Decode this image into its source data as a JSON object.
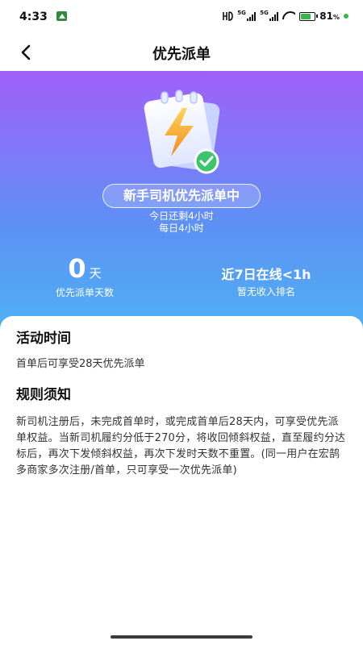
{
  "status_bar": {
    "time": "4:33",
    "signal1_tag": "5G",
    "signal2_tag": "5G",
    "battery_percent": "81",
    "battery_unit": "%",
    "battery_level": 0.81,
    "icons": [
      "notification-app-icon",
      "hd-icon",
      "signal-icon",
      "signal-icon",
      "wifi-icon",
      "battery-charging-icon"
    ]
  },
  "nav": {
    "back_icon": "chevron-left-icon",
    "title": "优先派单"
  },
  "hero": {
    "illustration_icon": "notepad-lightning-check-icon",
    "badge": "新手司机优先派单中",
    "remaining": "今日还剩4小时",
    "daily": "每日4小时",
    "stat_left_value": "0",
    "stat_left_unit": "天",
    "stat_left_caption": "优先派单天数",
    "stat_right_value": "近7日在线<1h",
    "stat_right_caption": "暂无收入排名"
  },
  "activity": {
    "title": "活动时间",
    "text": "首单后可享受28天优先派单"
  },
  "rules": {
    "title": "规则须知",
    "text": "新司机注册后，未完成首单时，或完成首单后28天内，可享受优先派单权益。当新司机履约分低于270分，将收回倾斜权益，直至履约分达标后，再次下发倾斜权益，再次下发时天数不重置。(同一用户在宏鹄多商家多次注册/首单，只可享受一次优先派单)"
  },
  "colors": {
    "hero_top": "#a060f8",
    "hero_bottom": "#4fb2f3",
    "check_green": "#3ec46d",
    "bolt_orange": "#f5a623"
  }
}
